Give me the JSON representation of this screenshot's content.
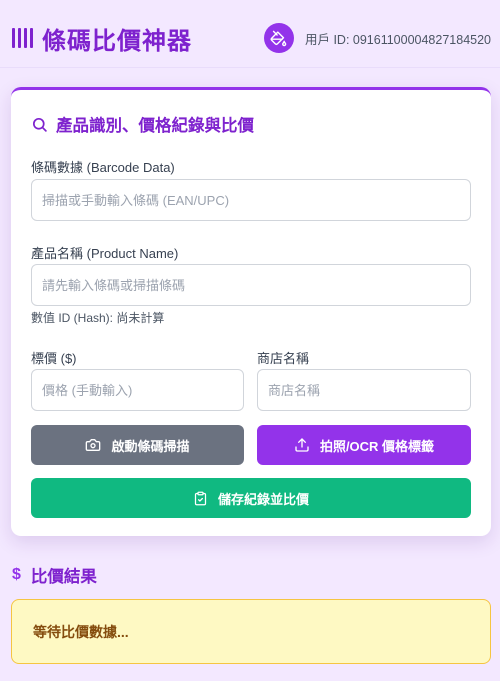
{
  "header": {
    "app_title": "條碼比價神器",
    "user_id_text": "用戶 ID: 09161100004827184520"
  },
  "form": {
    "heading": "產品識別、價格紀錄與比價",
    "barcode_label": "條碼數據 (Barcode Data)",
    "barcode_placeholder": "掃描或手動輸入條碼 (EAN/UPC)",
    "product_label": "產品名稱 (Product Name)",
    "product_placeholder": "請先輸入條碼或掃描條碼",
    "hash_note": "數值 ID (Hash): 尚未計算",
    "price_label": "標價 ($)",
    "price_placeholder": "價格 (手動輸入)",
    "store_label": "商店名稱",
    "store_placeholder": "商店名稱",
    "scan_button": "啟動條碼掃描",
    "ocr_button": "拍照/OCR 價格標籤",
    "save_button": "儲存紀錄並比價"
  },
  "results": {
    "dollar_symbol": "$",
    "heading": "比價結果",
    "waiting_text": "等待比價數據..."
  },
  "icons": {
    "logo": "barcode-icon",
    "user": "paint-bucket-icon",
    "form_heading": "search-icon",
    "scan": "camera-icon",
    "ocr": "upload-icon",
    "save": "clipboard-check-icon"
  },
  "colors": {
    "background": "#f3e8ff",
    "accent": "#9333ea",
    "title": "#7e22ce",
    "scan_button": "#6b7280",
    "save_button": "#10b981",
    "waiting_bg": "#fef9c3",
    "waiting_text": "#854d0e"
  }
}
